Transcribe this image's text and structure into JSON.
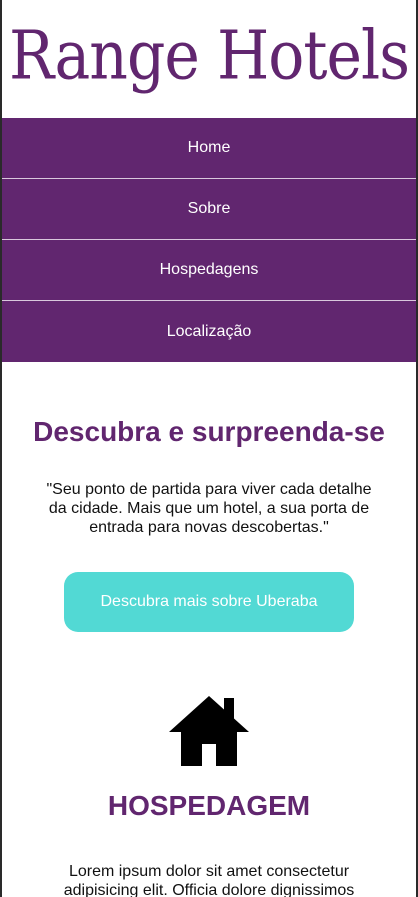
{
  "brand": {
    "logo_text": "Range Hotels",
    "primary_color": "#61266f",
    "accent_color": "#52d9d4"
  },
  "nav": {
    "items": [
      {
        "label": "Home"
      },
      {
        "label": "Sobre"
      },
      {
        "label": "Hospedagens"
      },
      {
        "label": "Localização"
      }
    ]
  },
  "hero": {
    "title": "Descubra e surpreenda-se",
    "quote": "\"Seu ponto de partida para viver cada detalhe da cidade. Mais que um hotel, a sua porta de entrada para novas descobertas.\"",
    "cta_label": "Descubra mais sobre Uberaba"
  },
  "lodging": {
    "icon": "house-icon",
    "title": "HOSPEDAGEM",
    "text": "Lorem ipsum dolor sit amet consectetur adipisicing elit. Officia dolore dignissimos"
  }
}
